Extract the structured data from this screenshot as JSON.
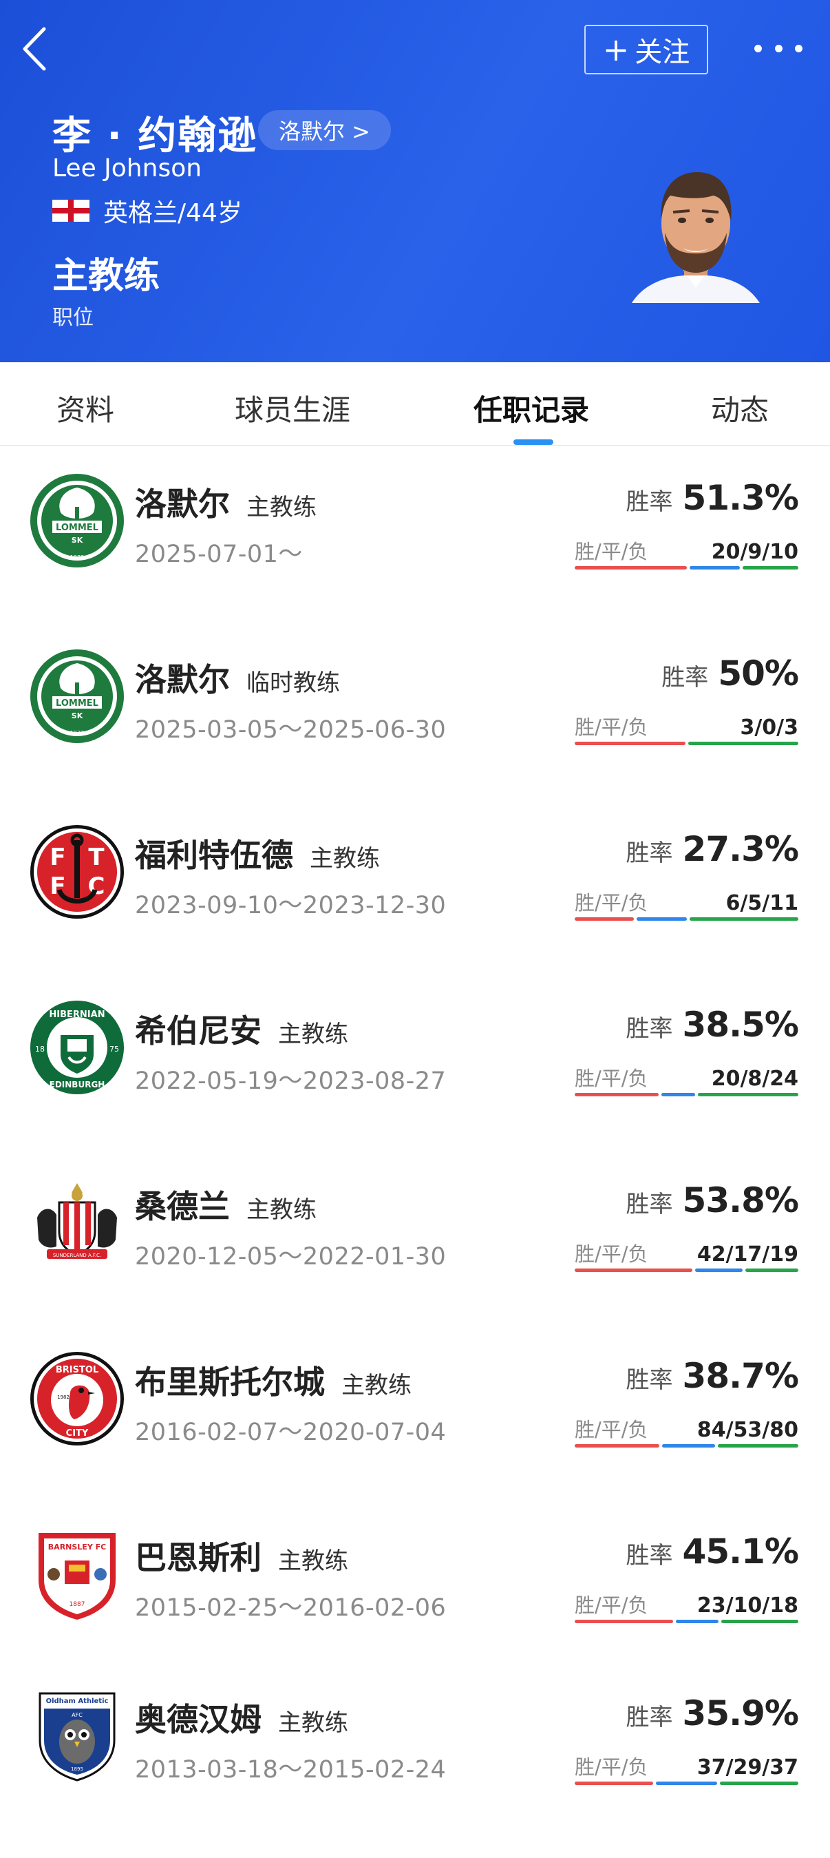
{
  "header": {
    "back_icon": "chevron-left-icon",
    "follow_label": "关注",
    "follow_icon": "plus-icon",
    "more_icon": "ellipsis-icon",
    "name_cn": "李 · 约翰逊",
    "current_team_chip": "洛默尔 >",
    "name_en": "Lee Johnson",
    "nationality_age": "英格兰/44岁",
    "position_title": "主教练",
    "position_label": "职位",
    "brand_color": "#2258e4"
  },
  "tabs": [
    {
      "label": "资料",
      "active": false
    },
    {
      "label": "球员生涯",
      "active": false
    },
    {
      "label": "任职记录",
      "active": true
    },
    {
      "label": "动态",
      "active": false
    }
  ],
  "records": [
    {
      "club": "洛默尔",
      "role": "主教练",
      "tenure": "2025-07-01～",
      "win_label": "胜率",
      "win_rate": "51.3%",
      "wdl_label": "胜/平/负",
      "wdl": "20/9/10",
      "w": 20,
      "d": 9,
      "l": 10,
      "crest": "lommel-crest-icon"
    },
    {
      "club": "洛默尔",
      "role": "临时教练",
      "tenure": "2025-03-05～2025-06-30",
      "win_label": "胜率",
      "win_rate": "50%",
      "wdl_label": "胜/平/负",
      "wdl": "3/0/3",
      "w": 3,
      "d": 0,
      "l": 3,
      "crest": "lommel-crest-icon"
    },
    {
      "club": "福利特伍德",
      "role": "主教练",
      "tenure": "2023-09-10～2023-12-30",
      "win_label": "胜率",
      "win_rate": "27.3%",
      "wdl_label": "胜/平/负",
      "wdl": "6/5/11",
      "w": 6,
      "d": 5,
      "l": 11,
      "crest": "fleetwood-crest-icon"
    },
    {
      "club": "希伯尼安",
      "role": "主教练",
      "tenure": "2022-05-19～2023-08-27",
      "win_label": "胜率",
      "win_rate": "38.5%",
      "wdl_label": "胜/平/负",
      "wdl": "20/8/24",
      "w": 20,
      "d": 8,
      "l": 24,
      "crest": "hibernian-crest-icon"
    },
    {
      "club": "桑德兰",
      "role": "主教练",
      "tenure": "2020-12-05～2022-01-30",
      "win_label": "胜率",
      "win_rate": "53.8%",
      "wdl_label": "胜/平/负",
      "wdl": "42/17/19",
      "w": 42,
      "d": 17,
      "l": 19,
      "crest": "sunderland-crest-icon"
    },
    {
      "club": "布里斯托尔城",
      "role": "主教练",
      "tenure": "2016-02-07～2020-07-04",
      "win_label": "胜率",
      "win_rate": "38.7%",
      "wdl_label": "胜/平/负",
      "wdl": "84/53/80",
      "w": 84,
      "d": 53,
      "l": 80,
      "crest": "bristol-city-crest-icon"
    },
    {
      "club": "巴恩斯利",
      "role": "主教练",
      "tenure": "2015-02-25～2016-02-06",
      "win_label": "胜率",
      "win_rate": "45.1%",
      "wdl_label": "胜/平/负",
      "wdl": "23/10/18",
      "w": 23,
      "d": 10,
      "l": 18,
      "crest": "barnsley-crest-icon"
    },
    {
      "club": "奥德汉姆",
      "role": "主教练",
      "tenure": "2013-03-18～2015-02-24",
      "win_label": "胜率",
      "win_rate": "35.9%",
      "wdl_label": "胜/平/负",
      "wdl": "37/29/37",
      "w": 37,
      "d": 29,
      "l": 37,
      "crest": "oldham-crest-icon"
    }
  ],
  "crest_texts": {
    "lommel": [
      "LOMMEL",
      "SK",
      "1932"
    ],
    "fleetwood": [
      "F",
      "T",
      "F",
      "C"
    ],
    "hibernian": [
      "HIBERNIAN",
      "EDINBURGH",
      "18",
      "75"
    ],
    "sunderland": [
      "SUNDERLAND A.F.C."
    ],
    "bristol": [
      "BRISTOL",
      "CITY",
      "1982"
    ],
    "barnsley": [
      "BARNSLEY FC",
      "1887"
    ],
    "oldham": [
      "Oldham Athletic",
      "AFC",
      "1895"
    ]
  },
  "colors": {
    "win": "#ea4f4f",
    "draw": "#2f86e8",
    "loss": "#27a44a",
    "tab_indicator": "#2a91f4"
  }
}
